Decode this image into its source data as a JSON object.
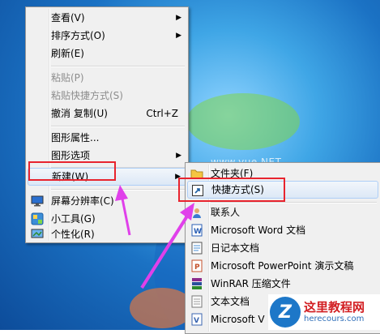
{
  "watermark": "www.yue.NET",
  "menu_main": {
    "items": [
      {
        "label": "查看(V)",
        "submenu": true
      },
      {
        "label": "排序方式(O)",
        "submenu": true
      },
      {
        "label": "刷新(E)"
      },
      {
        "label": "粘贴(P)",
        "disabled": true
      },
      {
        "label": "粘贴快捷方式(S)",
        "disabled": true
      },
      {
        "label": "撤消 复制(U)",
        "shortcut": "Ctrl+Z"
      },
      {
        "label": "图形属性..."
      },
      {
        "label": "图形选项",
        "submenu": true
      },
      {
        "label": "新建(W)",
        "submenu": true,
        "highlighted": true
      },
      {
        "label": "屏幕分辨率(C)",
        "icon": "monitor-icon"
      },
      {
        "label": "小工具(G)",
        "icon": "gadgets-icon"
      },
      {
        "label": "个性化(R)",
        "icon": "personalize-icon"
      }
    ]
  },
  "menu_new": {
    "items": [
      {
        "label": "文件夹(F)",
        "icon": "folder-icon"
      },
      {
        "label": "快捷方式(S)",
        "icon": "shortcut-icon",
        "highlighted": true
      },
      {
        "label": "联系人",
        "icon": "contact-icon"
      },
      {
        "label": "Microsoft Word 文档",
        "icon": "word-icon"
      },
      {
        "label": "日记本文档",
        "icon": "journal-icon"
      },
      {
        "label": "Microsoft PowerPoint 演示文稿",
        "icon": "powerpoint-icon"
      },
      {
        "label": "WinRAR 压缩文件",
        "icon": "winrar-icon"
      },
      {
        "label": "文本文档",
        "icon": "text-doc-icon"
      },
      {
        "label": "Microsoft V",
        "icon": "visio-icon"
      }
    ]
  },
  "logo": {
    "title": "这里教程网",
    "url": "herecours.com"
  },
  "colors": {
    "annotation_red": "#e8242e",
    "arrow_magenta": "#e040ea",
    "desktop_blue": "#1b72c4"
  }
}
